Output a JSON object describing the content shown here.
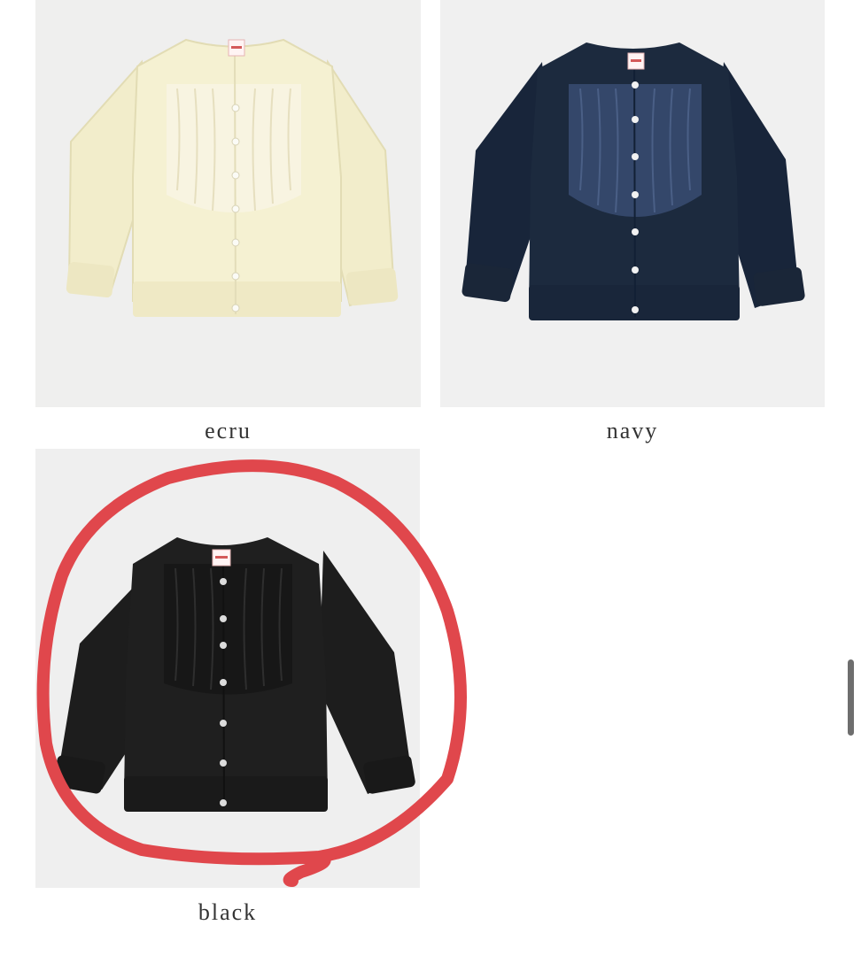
{
  "products": [
    {
      "color_label": "ecru",
      "swatch": "#f4f0cf",
      "ruffle": "#f6f2dc"
    },
    {
      "color_label": "navy",
      "swatch": "#1d2a3b",
      "ruffle": "#3a4d6e"
    },
    {
      "color_label": "black",
      "swatch": "#1c1c1c",
      "ruffle": "#141414"
    }
  ],
  "annotation": {
    "shape": "hand-drawn circle",
    "color": "#e0474c",
    "highlights": "black"
  },
  "scrollbar": {
    "color": "#6e6e6e"
  }
}
